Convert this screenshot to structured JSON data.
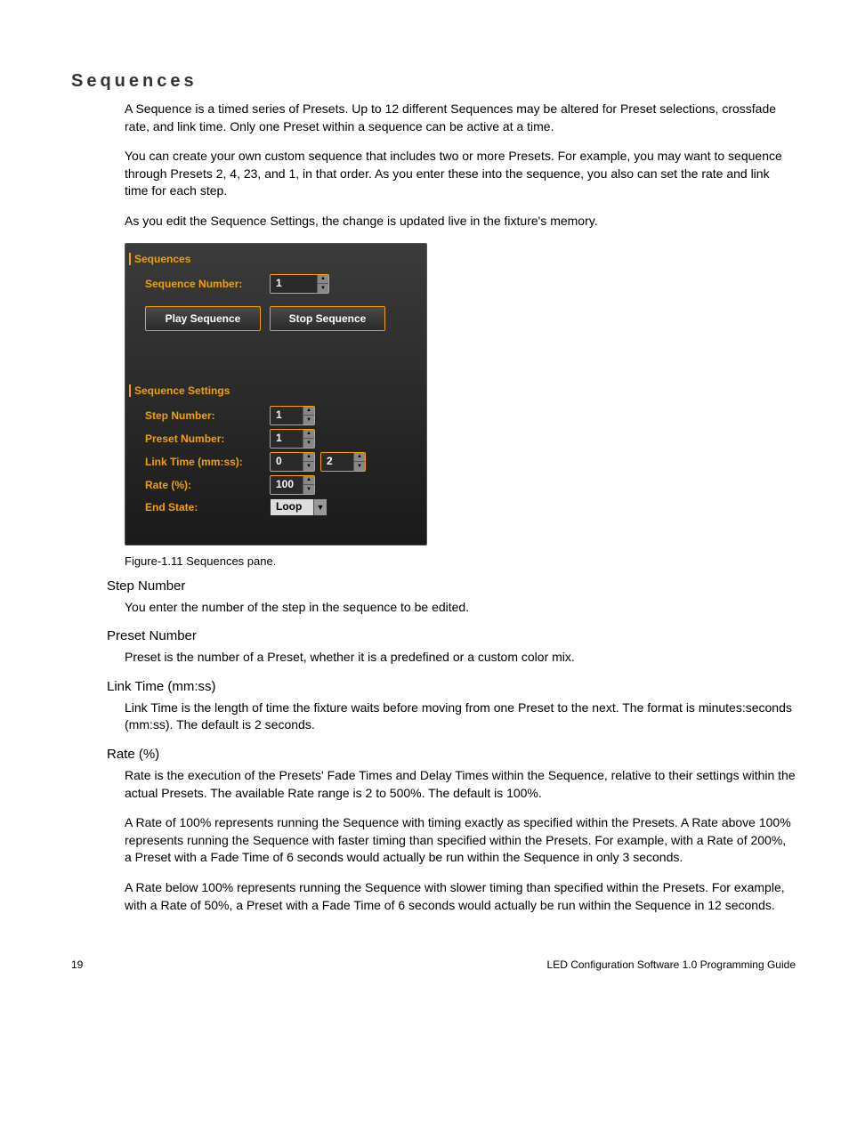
{
  "heading": "Sequences",
  "paragraphs": {
    "p1": "A Sequence is a timed series of Presets. Up to 12 different Sequences may be altered for Preset selections, crossfade rate, and link time. Only one Preset within a sequence can be active at a time.",
    "p2": "You can create your own custom sequence that includes two or more Presets. For example, you may want to sequence through Presets 2, 4, 23, and 1, in that order. As you enter these into the sequence, you also can set the rate and link time for each step.",
    "p3": "As you edit the Sequence Settings, the change is updated live in the fixture's memory."
  },
  "panel": {
    "group1": "Sequences",
    "seq_num_label": "Sequence Number:",
    "seq_num_value": "1",
    "play_btn": "Play Sequence",
    "stop_btn": "Stop Sequence",
    "group2": "Sequence Settings",
    "step_label": "Step Number:",
    "step_value": "1",
    "preset_label": "Preset Number:",
    "preset_value": "1",
    "link_label": "Link Time (mm:ss):",
    "link_mm": "0",
    "link_ss": "2",
    "rate_label": "Rate (%):",
    "rate_value": "100",
    "end_label": "End State:",
    "end_value": "Loop"
  },
  "caption": "Figure-1.11 Sequences pane.",
  "sections": {
    "step": {
      "h": "Step Number",
      "p": "You enter the number of the step in the sequence to be edited."
    },
    "preset": {
      "h": "Preset Number",
      "p": "Preset is the number of a Preset, whether it is a predefined or a custom color mix."
    },
    "link": {
      "h": "Link Time (mm:ss)",
      "p": "Link Time is the length of time the fixture waits before moving from one Preset to the next. The format is minutes:seconds (mm:ss). The default is 2 seconds."
    },
    "rate": {
      "h": "Rate (%)",
      "p1": "Rate is the execution of the Presets' Fade Times and Delay Times within the Sequence, relative to their settings within the actual Presets. The available Rate range is 2 to 500%. The default is 100%.",
      "p2": "A Rate of 100% represents running the Sequence with timing exactly as specified within the Presets. A Rate above 100% represents running the Sequence with faster timing than specified within the Presets. For example, with a Rate of 200%, a Preset with a Fade Time of 6 seconds would actually be run within the Sequence in only 3 seconds.",
      "p3": "A Rate below 100% represents running the Sequence with slower timing than specified within the Presets. For example, with a Rate of 50%, a Preset with a Fade Time of 6 seconds would actually be run within the Sequence in 12 seconds."
    }
  },
  "footer": {
    "page": "19",
    "title": "LED Configuration Software 1.0 Programming Guide"
  }
}
